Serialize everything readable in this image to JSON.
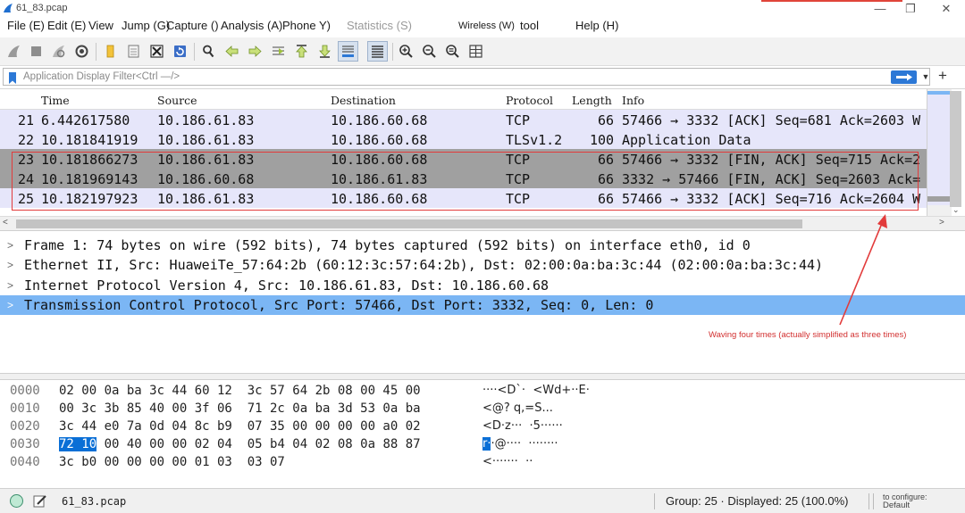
{
  "window": {
    "title": "61_83.pcap",
    "controls": {
      "minimize": "—",
      "maximize": "❐",
      "close": "✕"
    }
  },
  "menu": {
    "items": [
      "File (E)",
      "Edit (E)",
      "View",
      "Jump (G)",
      "Capture ()",
      "Analysis (A)",
      "Phone Y)",
      "Statistics (S)",
      "Wireless (W)",
      "tool",
      "Help (H)"
    ]
  },
  "toolbar": {
    "icons": [
      "shark-fin-start-icon",
      "stop-capture-icon",
      "restart-capture-icon",
      "capture-options-icon",
      "open-file-icon",
      "save-file-icon",
      "close-file-icon",
      "reload-icon",
      "find-packet-icon",
      "go-back-icon",
      "go-forward-icon",
      "go-to-packet-icon",
      "go-first-icon",
      "go-last-icon",
      "auto-scroll-icon",
      "colorize-icon",
      "zoom-in-icon",
      "zoom-out-icon",
      "zoom-normal-icon",
      "resize-columns-icon"
    ]
  },
  "filter": {
    "placeholder": "Application Display Filter<Ctrl —/>",
    "value": "",
    "add_label": "+"
  },
  "packet_list": {
    "columns": [
      "Time",
      "Source",
      "Destination",
      "Protocol",
      "Length",
      "Info"
    ],
    "rows": [
      {
        "no": "21",
        "time": "6.442617580",
        "src": "10.186.61.83",
        "dst": "10.186.60.68",
        "proto": "TCP",
        "len": "66",
        "info": "57466 → 3332 [ACK] Seq=681 Ack=2603 W",
        "bg": "#e6e6fa"
      },
      {
        "no": "22",
        "time": "10.181841919",
        "src": "10.186.61.83",
        "dst": "10.186.60.68",
        "proto": "TLSv1.2",
        "len": "100",
        "info": "Application Data",
        "bg": "#e6e6fa"
      },
      {
        "no": "23",
        "time": "10.181866273",
        "src": "10.186.61.83",
        "dst": "10.186.60.68",
        "proto": "TCP",
        "len": "66",
        "info": "57466 → 3332 [FIN, ACK] Seq=715 Ack=2",
        "bg": "#a0a0a0"
      },
      {
        "no": "24",
        "time": "10.181969143",
        "src": "10.186.60.68",
        "dst": "10.186.61.83",
        "proto": "TCP",
        "len": "66",
        "info": "3332 → 57466 [FIN, ACK] Seq=2603 Ack=",
        "bg": "#a0a0a0"
      },
      {
        "no": "25",
        "time": "10.182197923",
        "src": "10.186.61.83",
        "dst": "10.186.60.68",
        "proto": "TCP",
        "len": "66",
        "info": "57466 → 3332 [ACK] Seq=716 Ack=2604 W",
        "bg": "#e6e6fa"
      }
    ]
  },
  "annotation": {
    "text": "Waving four times (actually simplified as three times)",
    "color": "#d23030"
  },
  "details": {
    "rows": [
      {
        "text": "Frame 1: 74 bytes on wire (592 bits), 74 bytes captured (592 bits) on interface eth0, id 0",
        "selected": false
      },
      {
        "text": "Ethernet II, Src: HuaweiTe_57:64:2b (60:12:3c:57:64:2b), Dst: 02:00:0a:ba:3c:44 (02:00:0a:ba:3c:44)",
        "selected": false
      },
      {
        "text": "Internet Protocol Version 4, Src: 10.186.61.83, Dst: 10.186.60.68",
        "selected": false
      },
      {
        "text": "Transmission Control Protocol, Src Port: 57466, Dst Port: 3332, Seq: 0, Len: 0",
        "selected": true
      }
    ]
  },
  "bytes": {
    "rows": [
      {
        "offset": "0000",
        "hex_pre": "",
        "hex_hl": "",
        "hex_post": "02 00 0a ba 3c 44 60 12  3c 57 64 2b 08 00 45 00",
        "ascii_pre": "",
        "ascii_hl": "",
        "ascii_post": "····<D`·  <Wd+··E·"
      },
      {
        "offset": "0010",
        "hex_pre": "",
        "hex_hl": "",
        "hex_post": "00 3c 3b 85 40 00 3f 06  71 2c 0a ba 3d 53 0a ba",
        "ascii_pre": "",
        "ascii_hl": "",
        "ascii_post": "<@? q,=S..."
      },
      {
        "offset": "0020",
        "hex_pre": "",
        "hex_hl": "",
        "hex_post": "3c 44 e0 7a 0d 04 8c b9  07 35 00 00 00 00 a0 02",
        "ascii_pre": "",
        "ascii_hl": "",
        "ascii_post": "<D·z···  ·5······"
      },
      {
        "offset": "0030",
        "hex_pre": "",
        "hex_hl": "72 10",
        "hex_post": " 00 40 00 00 02 04  05 b4 04 02 08 0a 88 87",
        "ascii_pre": "",
        "ascii_hl": "r·",
        "ascii_post": "·@····  ········"
      },
      {
        "offset": "0040",
        "hex_pre": "",
        "hex_hl": "",
        "hex_post": "3c b0 00 00 00 00 01 03  03 07",
        "ascii_pre": "",
        "ascii_hl": "",
        "ascii_post": "<·······  ··"
      }
    ],
    "highlight_color": "#0a6fd6"
  },
  "status": {
    "file": "61_83.pcap",
    "packets": "Group: 25 · Displayed: 25 (100.0%)",
    "profile_top": "to configure:",
    "profile_bottom": "Default"
  },
  "colors": {
    "selected_row": "#7bb6f4",
    "row_lavender": "#e6e6fa",
    "row_gray": "#a0a0a0",
    "apply_button": "#2c78d6"
  }
}
